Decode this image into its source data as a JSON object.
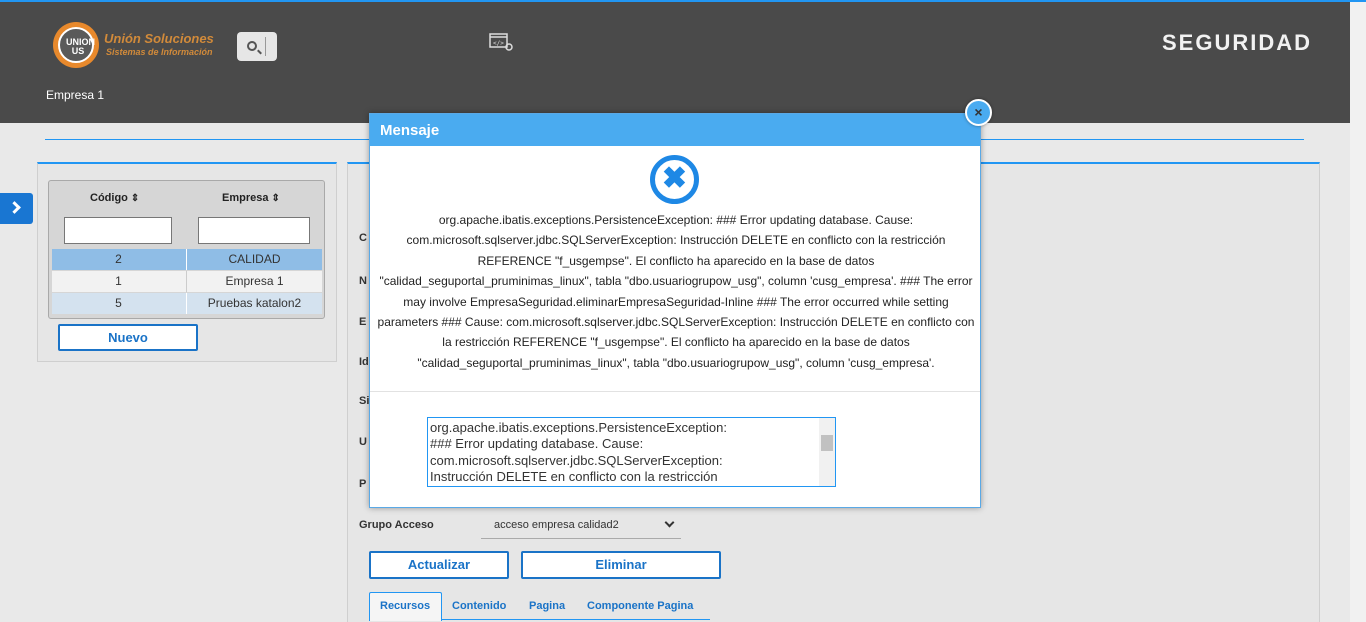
{
  "header": {
    "brand_name": "Unión Soluciones",
    "brand_tagline": "Sistemas de Información",
    "logo_text": "UNION US",
    "module_title": "SEGURIDAD",
    "company": "Empresa 1",
    "colors": {
      "header_bg": "#4a4a4a",
      "accent": "#2196f3",
      "brand": "#d18a3a"
    }
  },
  "table": {
    "col_code": "Código",
    "col_company": "Empresa",
    "rows": [
      {
        "code": "2",
        "company": "CALIDAD",
        "selected": true
      },
      {
        "code": "1",
        "company": "Empresa 1",
        "selected": false
      },
      {
        "code": "5",
        "company": "Pruebas katalon2",
        "selected": false
      }
    ]
  },
  "buttons": {
    "nuevo": "Nuevo",
    "actualizar": "Actualizar",
    "eliminar": "Eliminar"
  },
  "form": {
    "labels": [
      "C",
      "N",
      "E",
      "Id",
      "Si",
      "U",
      "P"
    ],
    "grupo_acceso_label": "Grupo Acceso",
    "grupo_acceso_value": "acceso empresa calidad2"
  },
  "tabs": [
    "Recursos",
    "Contenido",
    "Pagina",
    "Componente Pagina"
  ],
  "modal": {
    "title": "Mensaje",
    "close_glyph": "×",
    "error_glyph": "✖",
    "message": "org.apache.ibatis.exceptions.PersistenceException: ### Error updating database. Cause: com.microsoft.sqlserver.jdbc.SQLServerException: Instrucción DELETE en conflicto con la restricción REFERENCE \"f_usgempse\". El conflicto ha aparecido en la base de datos \"calidad_seguportal_pruminimas_linux\", tabla \"dbo.usuariogrupow_usg\", column 'cusg_empresa'. ### The error may involve EmpresaSeguridad.eliminarEmpresaSeguridad-Inline ### The error occurred while setting parameters ### Cause: com.microsoft.sqlserver.jdbc.SQLServerException: Instrucción DELETE en conflicto con la restricción REFERENCE \"f_usgempse\". El conflicto ha aparecido en la base de datos \"calidad_seguportal_pruminimas_linux\", tabla \"dbo.usuariogrupow_usg\", column 'cusg_empresa'.",
    "textarea_text": "org.apache.ibatis.exceptions.PersistenceException:\n### Error updating database.  Cause:\ncom.microsoft.sqlserver.jdbc.SQLServerException:\nInstrucción DELETE en conflicto con la restricción"
  }
}
